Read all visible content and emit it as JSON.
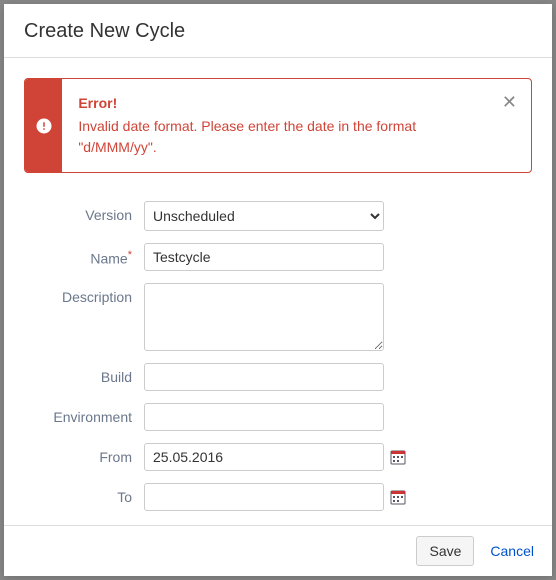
{
  "header": {
    "title": "Create New Cycle"
  },
  "alert": {
    "title": "Error!",
    "message": "Invalid date format. Please enter the date in the format \"d/MMM/yy\"."
  },
  "form": {
    "version": {
      "label": "Version",
      "value": "Unscheduled"
    },
    "name": {
      "label": "Name",
      "value": "Testcycle"
    },
    "description": {
      "label": "Description",
      "value": ""
    },
    "build": {
      "label": "Build",
      "value": ""
    },
    "environment": {
      "label": "Environment",
      "value": ""
    },
    "from": {
      "label": "From",
      "value": "25.05.2016"
    },
    "to": {
      "label": "To",
      "value": ""
    }
  },
  "footer": {
    "save": "Save",
    "cancel": "Cancel"
  }
}
